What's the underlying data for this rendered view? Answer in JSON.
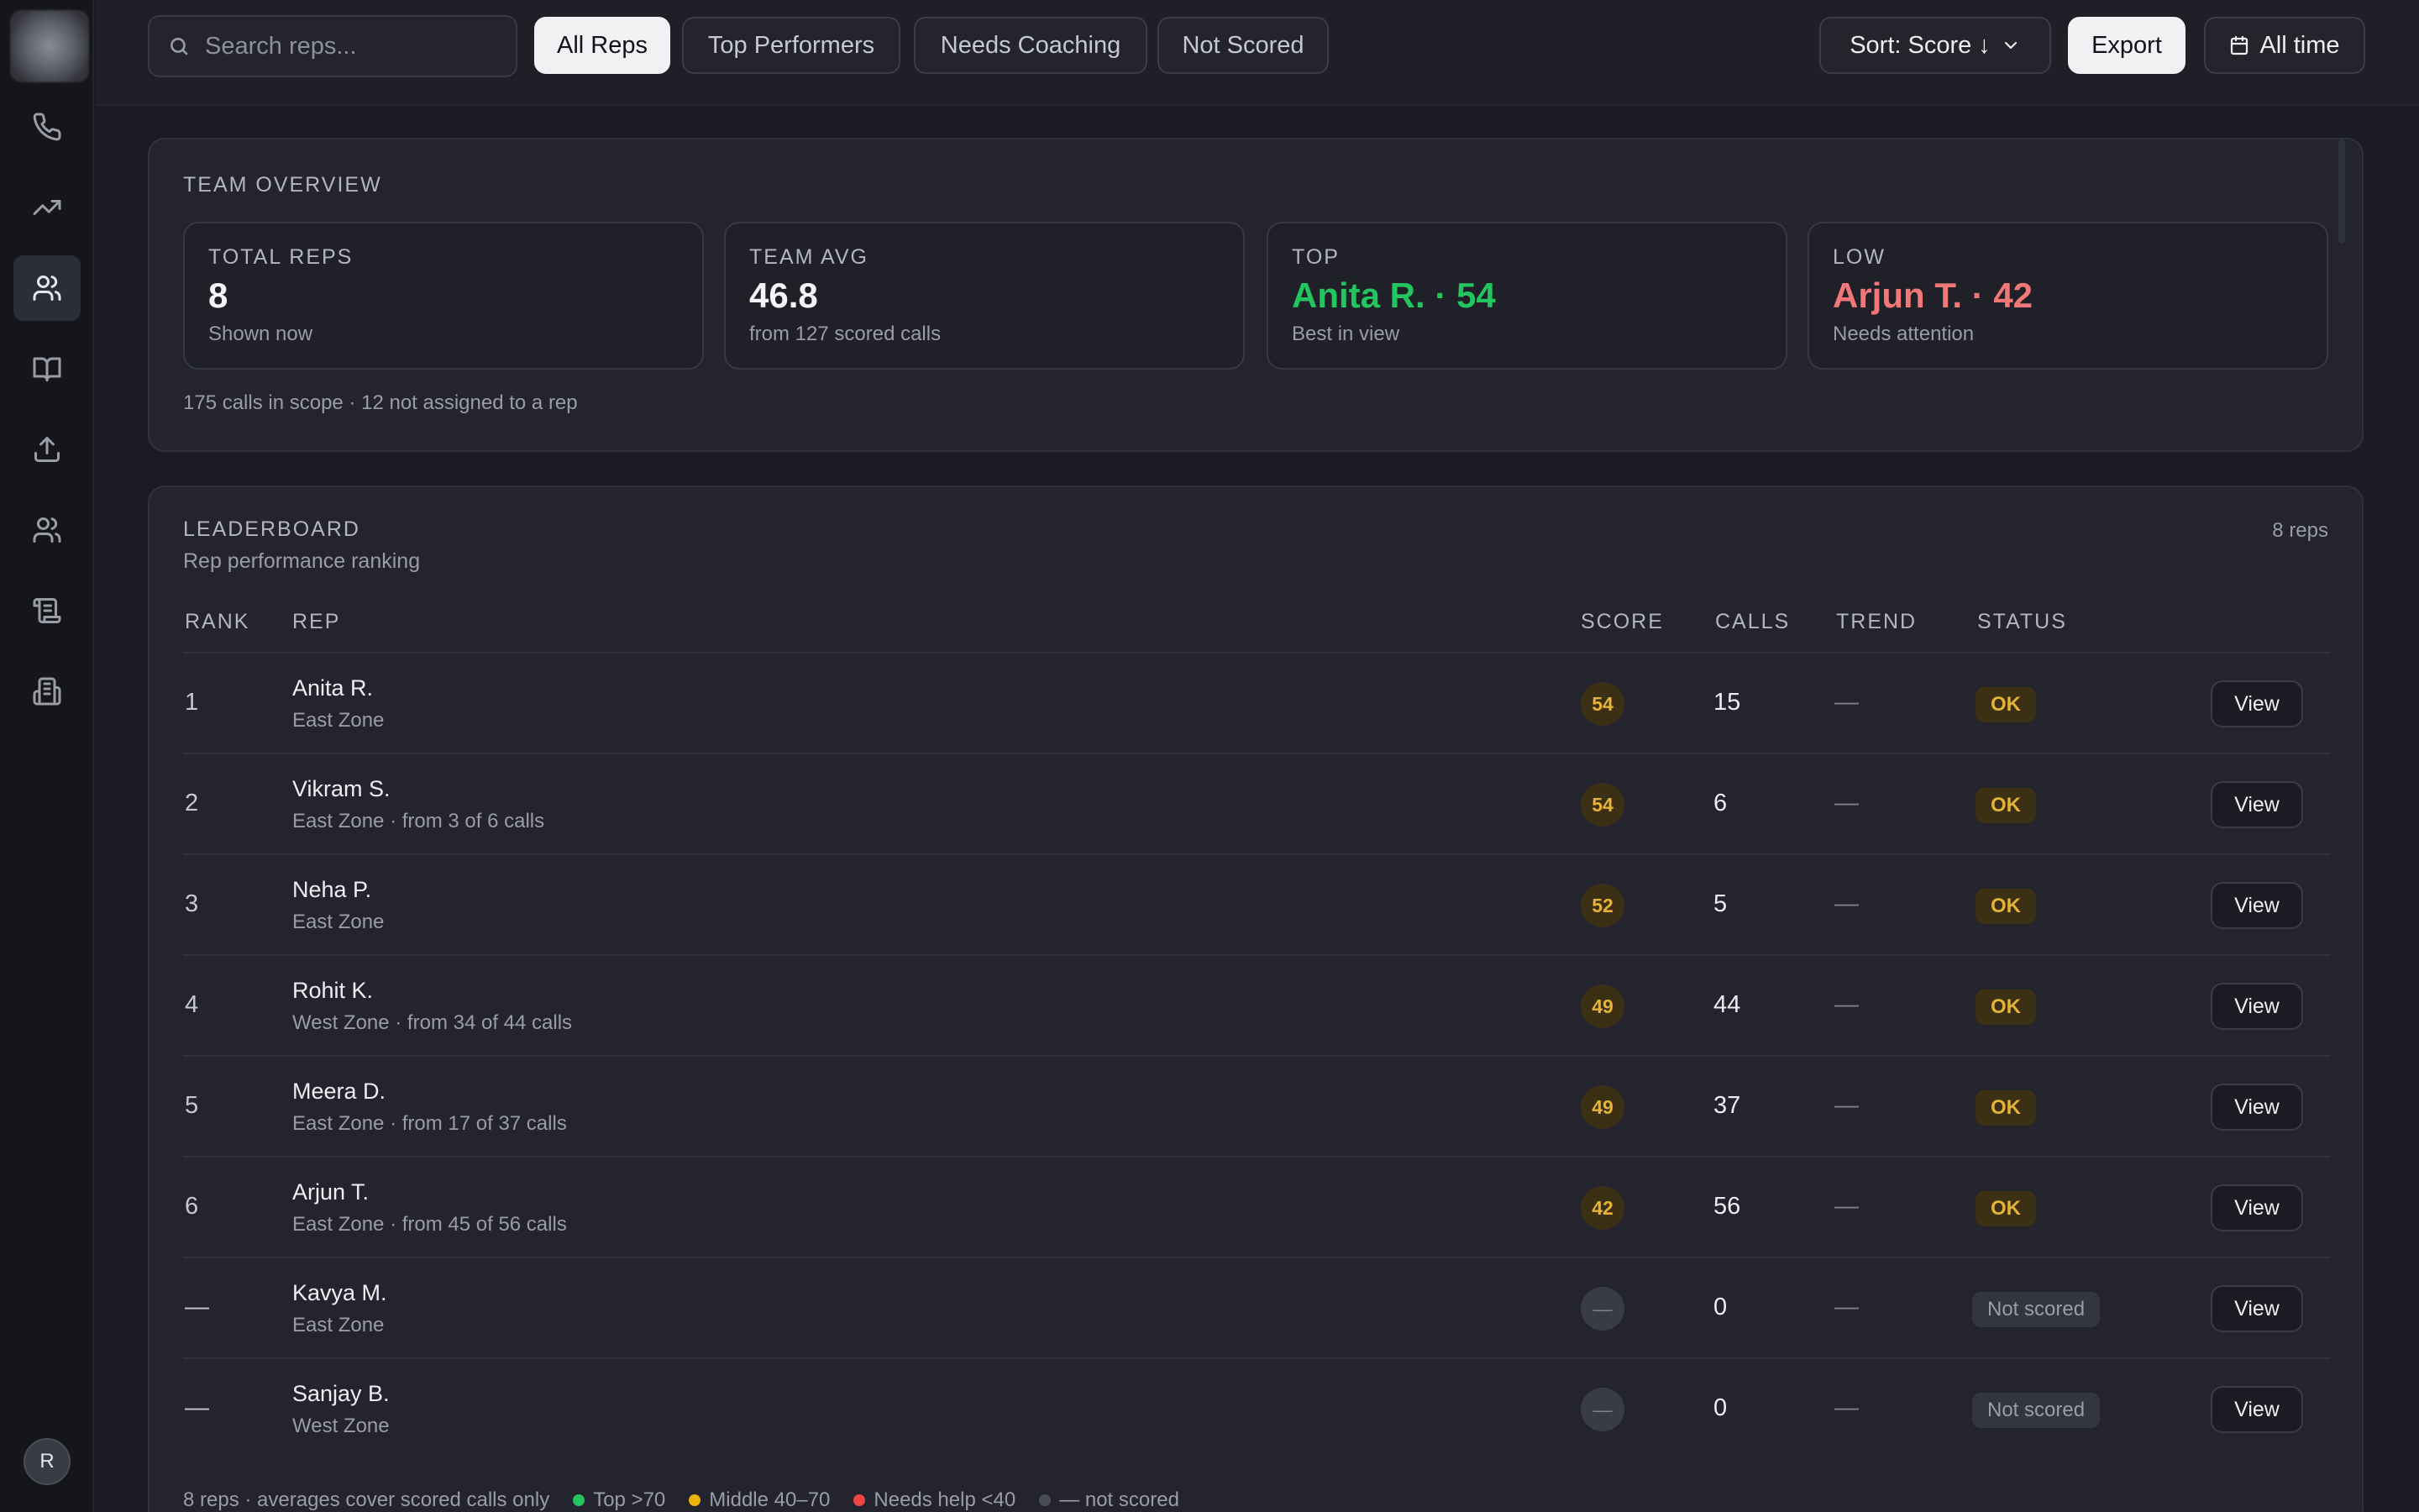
{
  "sidebar": {
    "items": [
      {
        "name": "nav-calls",
        "icon": "phone-icon"
      },
      {
        "name": "nav-analytics",
        "icon": "trending-up-icon"
      },
      {
        "name": "nav-reps",
        "icon": "users-icon",
        "active": true
      },
      {
        "name": "nav-library",
        "icon": "book-icon"
      },
      {
        "name": "nav-upload",
        "icon": "upload-icon"
      },
      {
        "name": "nav-team",
        "icon": "users-icon"
      },
      {
        "name": "nav-scripts",
        "icon": "scroll-icon"
      },
      {
        "name": "nav-company",
        "icon": "building-icon"
      }
    ],
    "avatar_initial": "R"
  },
  "toolbar": {
    "search_placeholder": "Search reps...",
    "filters": [
      "All Reps",
      "Top Performers",
      "Needs Coaching",
      "Not Scored"
    ],
    "active_filter": "All Reps",
    "sort_label": "Sort: Score ↓",
    "export_label": "Export",
    "range_label": "All time"
  },
  "overview": {
    "title": "TEAM OVERVIEW",
    "stats": [
      {
        "label": "TOTAL REPS",
        "value": "8",
        "sub": "Shown now"
      },
      {
        "label": "TEAM AVG",
        "value": "46.8",
        "sub": "from 127 scored calls"
      },
      {
        "label": "TOP",
        "value": "Anita R. · 54",
        "sub": "Best in view"
      },
      {
        "label": "LOW",
        "value": "Arjun T. · 42",
        "sub": "Needs attention"
      }
    ],
    "scope_note": "175 calls in scope · 12 not assigned to a rep"
  },
  "leaderboard": {
    "title": "LEADERBOARD",
    "subtitle": "Rep performance ranking",
    "count": "8 reps",
    "columns": {
      "rank": "RANK",
      "rep": "REP",
      "score": "SCORE",
      "calls": "CALLS",
      "trend": "TREND",
      "status": "STATUS"
    },
    "rows": [
      {
        "rank": "1",
        "name": "Anita R.",
        "meta": "East Zone",
        "score": "54",
        "calls": "15",
        "trend": "—",
        "status": "OK",
        "view": "View"
      },
      {
        "rank": "2",
        "name": "Vikram S.",
        "meta": "East Zone · from 3 of 6 calls",
        "score": "54",
        "calls": "6",
        "trend": "—",
        "status": "OK",
        "view": "View"
      },
      {
        "rank": "3",
        "name": "Neha P.",
        "meta": "East Zone",
        "score": "52",
        "calls": "5",
        "trend": "—",
        "status": "OK",
        "view": "View"
      },
      {
        "rank": "4",
        "name": "Rohit K.",
        "meta": "West Zone · from 34 of 44 calls",
        "score": "49",
        "calls": "44",
        "trend": "—",
        "status": "OK",
        "view": "View"
      },
      {
        "rank": "5",
        "name": "Meera D.",
        "meta": "East Zone · from 17 of 37 calls",
        "score": "49",
        "calls": "37",
        "trend": "—",
        "status": "OK",
        "view": "View"
      },
      {
        "rank": "6",
        "name": "Arjun T.",
        "meta": "East Zone · from 45 of 56 calls",
        "score": "42",
        "calls": "56",
        "trend": "—",
        "status": "OK",
        "view": "View"
      },
      {
        "rank": "—",
        "name": "Kavya M.",
        "meta": "East Zone",
        "score": "—",
        "calls": "0",
        "trend": "—",
        "status": "Not scored",
        "view": "View"
      },
      {
        "rank": "—",
        "name": "Sanjay B.",
        "meta": "West Zone",
        "score": "—",
        "calls": "0",
        "trend": "—",
        "status": "Not scored",
        "view": "View"
      }
    ],
    "footer": {
      "note": "8 reps · averages cover scored calls only",
      "legend": [
        {
          "label": "Top >70",
          "color": "#22c55e"
        },
        {
          "label": "Middle 40–70",
          "color": "#eab308"
        },
        {
          "label": "Needs help <40",
          "color": "#ef4444"
        },
        {
          "label": "— not scored",
          "color": "#4b4d56"
        }
      ]
    }
  },
  "colors": {
    "accent_green": "#22c55e",
    "accent_red": "#f07878",
    "score_amber": "#e6b23a"
  }
}
